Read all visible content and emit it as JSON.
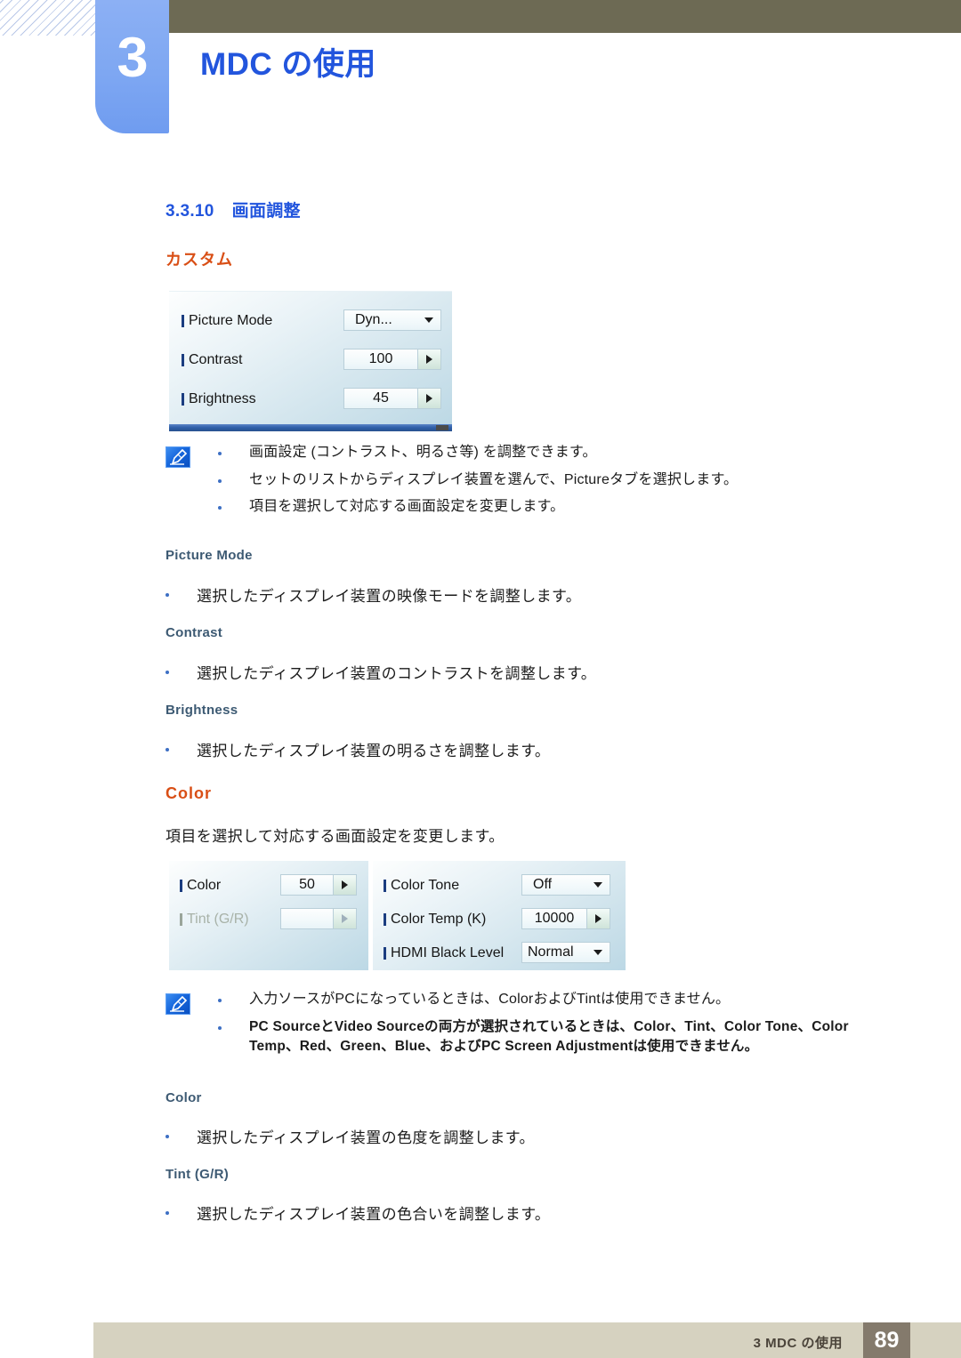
{
  "header": {
    "chapter_number": "3",
    "chapter_title": "MDC の使用"
  },
  "section": {
    "number": "3.3.10",
    "title": "画面調整"
  },
  "subheads": {
    "custom": "カスタム",
    "color": "Color"
  },
  "picture_panel": {
    "rows": [
      {
        "label": "Picture Mode",
        "value": "Dyn...",
        "control": "dropdown",
        "disabled": false
      },
      {
        "label": "Contrast",
        "value": "100",
        "control": "spinner",
        "disabled": false
      },
      {
        "label": "Brightness",
        "value": "45",
        "control": "spinner",
        "disabled": false
      }
    ]
  },
  "note1": {
    "icon": "note-pen-icon",
    "bullets": [
      "画面設定 (コントラスト、明るさ等) を調整できます。",
      "セットのリストからディスプレイ装置を選んで、Pictureタブを選択します。",
      "項目を選択して対応する画面設定を変更します。"
    ]
  },
  "terms1": [
    {
      "name": "Picture Mode",
      "desc": "選択したディスプレイ装置の映像モードを調整します。"
    },
    {
      "name": "Contrast",
      "desc": "選択したディスプレイ装置のコントラストを調整します。"
    },
    {
      "name": "Brightness",
      "desc": "選択したディスプレイ装置の明るさを調整します。"
    }
  ],
  "color_intro": "項目を選択して対応する画面設定を変更します。",
  "color_panel_left": {
    "rows": [
      {
        "label": "Color",
        "value": "50",
        "control": "spinner",
        "disabled": false
      },
      {
        "label": "Tint (G/R)",
        "value": "",
        "control": "spinner",
        "disabled": true
      }
    ]
  },
  "color_panel_right": {
    "rows": [
      {
        "label": "Color Tone",
        "value": "Off",
        "control": "dropdown",
        "disabled": false
      },
      {
        "label": "Color Temp (K)",
        "value": "10000",
        "control": "spinner",
        "disabled": false
      },
      {
        "label": "HDMI Black Level",
        "value": "Normal",
        "control": "dropdown",
        "disabled": false
      }
    ]
  },
  "note2": {
    "icon": "note-pen-icon",
    "bullets": [
      "入力ソースがPCになっているときは、ColorおよびTintは使用できません。",
      "PC SourceとVideo Sourceの両方が選択されているときは、Color、Tint、Color Tone、Color Temp、Red、Green、Blue、およびPC Screen Adjustmentは使用できません。"
    ]
  },
  "terms2": [
    {
      "name": "Color",
      "desc": "選択したディスプレイ装置の色度を調整します。"
    },
    {
      "name": "Tint (G/R)",
      "desc": "選択したディスプレイ装置の色合いを調整します。"
    }
  ],
  "footer": {
    "text": "3 MDC の使用",
    "page": "89"
  },
  "colors": {
    "accent_blue": "#2255dd",
    "accent_orange": "#d94f16",
    "olive": "#6d6a54",
    "tab_blue": "#7ea7f2",
    "footer_beige": "#d6d2c0",
    "footer_page_brown": "#847a6c"
  }
}
